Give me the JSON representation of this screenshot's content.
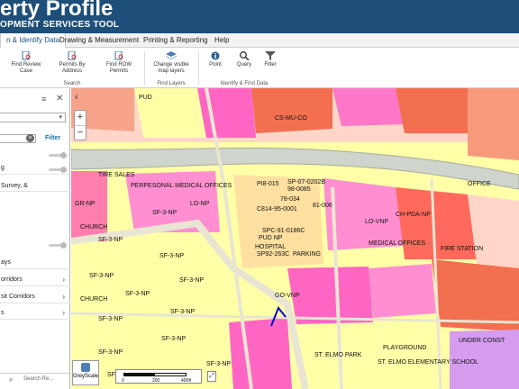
{
  "header": {
    "title": "erty Profile",
    "subtitle": "OPMENT SERVICES TOOL"
  },
  "tabs": [
    {
      "label": "n & Identify Data",
      "active": true
    },
    {
      "label": "Drawing & Measurement",
      "active": false
    },
    {
      "label": "Printing & Reporting",
      "active": false
    },
    {
      "label": "Help",
      "active": false
    }
  ],
  "ribbon": {
    "groups": [
      {
        "name": "Search",
        "buttons": [
          {
            "label": "Find Review Case",
            "icon": "document-search-icon"
          },
          {
            "label": "Permits By Address",
            "icon": "permits-search-icon"
          },
          {
            "label": "Find ROW Permits",
            "icon": "row-permits-search-icon"
          }
        ]
      },
      {
        "name": "Find Layers",
        "buttons": [
          {
            "label": "Change visible map layers",
            "icon": "layers-icon"
          }
        ]
      },
      {
        "name": "Identify & Find Data",
        "buttons": [
          {
            "label": "Point",
            "icon": "info-icon"
          },
          {
            "label": "Query",
            "icon": "query-icon"
          },
          {
            "label": "Filter",
            "icon": "filter-icon"
          }
        ]
      }
    ]
  },
  "sidebar": {
    "filter_label": "Filter",
    "search_placeholder": "Search Re...",
    "items": [
      {
        "label": "g"
      },
      {
        "label": "Survey, &"
      },
      {
        "label": "ays"
      },
      {
        "label": "orridors"
      },
      {
        "label": "sit Corridors"
      },
      {
        "label": "s"
      }
    ]
  },
  "map": {
    "greyscale_label": "GreyScale",
    "scale_ticks": [
      "0",
      "200",
      "400ft"
    ],
    "zone_labels": [
      "SF-3-NP",
      "SF-3-NP",
      "SF-3-NP",
      "SF-3-NP",
      "SF-3-NP",
      "SF-3-NP",
      "SF-3-NP",
      "SF-3-NP",
      "SF-3-NP",
      "SF-3-NP",
      "SF-3-NP",
      "SF-3-NP",
      "PUD",
      "GR-NP",
      "LO-NP",
      "LO-VNP",
      "GO-VNP",
      "CS-MU-CO",
      "CH-PDA-NP",
      "MEDICAL OFFICES",
      "PARKING",
      "HOSPITAL",
      "PUD NP",
      "PLAYGROUND",
      "ST. ELMO PARK",
      "ST. ELMO ELEMENTARY SCHOOL",
      "CHURCH",
      "UNDER CONST",
      "FIRE STATION"
    ],
    "street_labels": [
      "CHURCH",
      "PERPESONAL MEDICAL OFFICES",
      "TIRE SALES",
      "OFFICE"
    ],
    "case_labels": [
      "PI8-015",
      "SP-07-0202B",
      "98-0085",
      "78-034",
      "C814-95-0001",
      "SPC-91-0186C",
      "81-006",
      "SP92-263C"
    ]
  }
}
